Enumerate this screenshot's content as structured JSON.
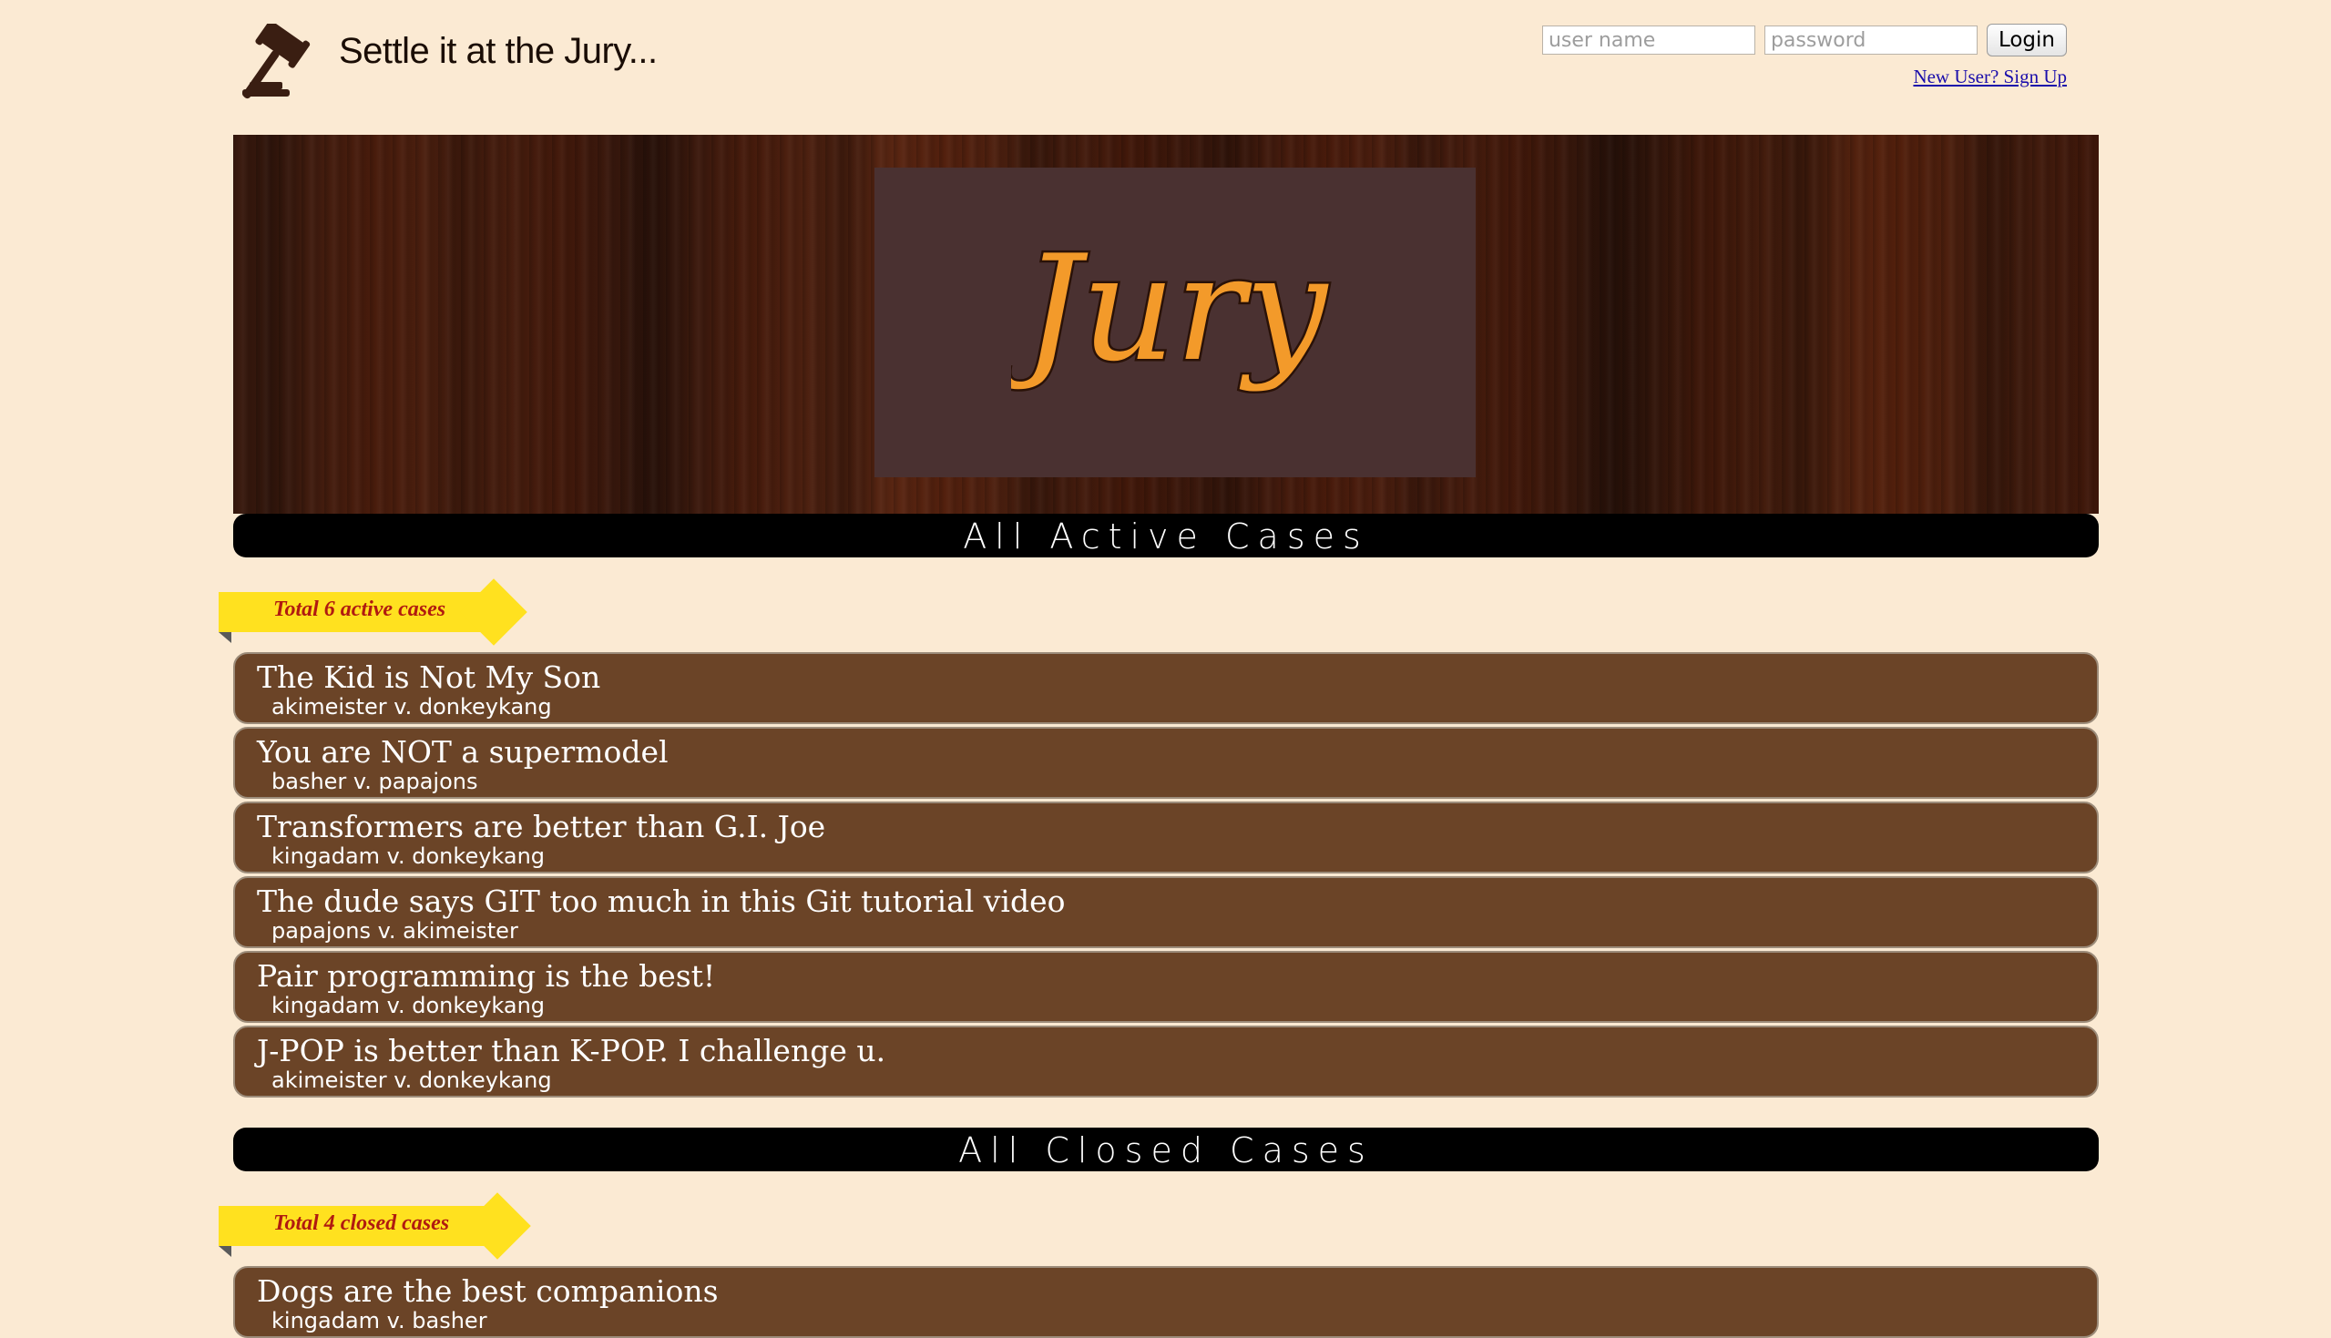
{
  "header": {
    "site_title": "Settle it at the Jury...",
    "username_placeholder": "user name",
    "password_placeholder": "password",
    "login_label": "Login",
    "signup_label": "New User? Sign Up"
  },
  "banner": {
    "logo_text": "Jury",
    "logo_color": "#f39a2a"
  },
  "active": {
    "section_title": "All  Active  Cases",
    "count_label": "Total 6 active cases",
    "cases": [
      {
        "title": "The Kid is Not My Son",
        "parties": "akimeister v. donkeykang"
      },
      {
        "title": "You are NOT a supermodel",
        "parties": "basher v. papajons"
      },
      {
        "title": "Transformers are better than G.I. Joe",
        "parties": "kingadam v. donkeykang"
      },
      {
        "title": "The dude says GIT too much in this Git tutorial video",
        "parties": "papajons v. akimeister"
      },
      {
        "title": "Pair programming is the best!",
        "parties": "kingadam v. donkeykang"
      },
      {
        "title": "J-POP is better than K-POP. I challenge u.",
        "parties": "akimeister v. donkeykang"
      }
    ]
  },
  "closed": {
    "section_title": "All  Closed  Cases",
    "count_label": "Total 4 closed cases",
    "cases": [
      {
        "title": "Dogs are the best companions",
        "parties": "kingadam v. basher"
      }
    ]
  },
  "colors": {
    "page_bg": "#fbead3",
    "case_bg": "#6b4427",
    "ribbon": "#ffe11f",
    "ribbon_text": "#b01a10"
  }
}
